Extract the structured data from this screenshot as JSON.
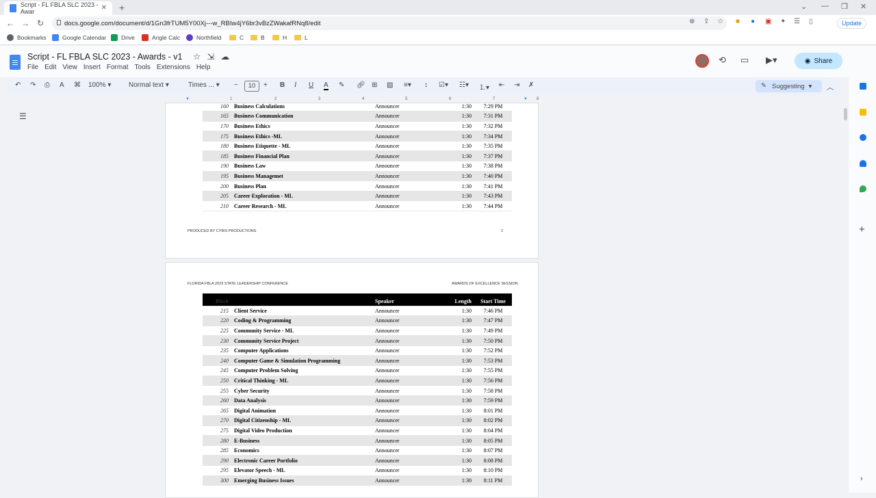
{
  "browser": {
    "tab_title": "Script - FL FBLA SLC 2023 - Awar",
    "url": "docs.google.com/document/d/1Gn3frTUM5Y00Xj---w_RBIw4jY6br3vBzZWakafRNq8/edit",
    "update_label": "Update",
    "bookmarks": [
      {
        "label": "Bookmarks",
        "icon": "star-icon",
        "color": "#5f6368"
      },
      {
        "label": "Google Calendar",
        "icon": "calendar-icon",
        "color": "#4285f4"
      },
      {
        "label": "Drive",
        "icon": "drive-icon",
        "color": "#0f9d58"
      },
      {
        "label": "Angle Calc",
        "icon": "calculator-icon",
        "color": "#d93025"
      },
      {
        "label": "Northfield",
        "icon": "peace-icon",
        "color": "#5f3dc4"
      },
      {
        "label": "C",
        "icon": "folder-icon",
        "color": "#f2c94c"
      },
      {
        "label": "B",
        "icon": "folder-icon",
        "color": "#f2c94c"
      },
      {
        "label": "H",
        "icon": "folder-icon",
        "color": "#f2c94c"
      },
      {
        "label": "L",
        "icon": "folder-icon",
        "color": "#f2c94c"
      }
    ]
  },
  "docs": {
    "title": "Script - FL FBLA SLC 2023 - Awards - v1",
    "menus": [
      "File",
      "Edit",
      "View",
      "Insert",
      "Format",
      "Tools",
      "Extensions",
      "Help"
    ],
    "share_label": "Share",
    "zoom": "100%",
    "style": "Normal text",
    "font": "Times ...",
    "font_size": "10",
    "mode": "Suggesting"
  },
  "page1": {
    "footer_left": "PRODUCED BY CYBIS PRODUCTIONS",
    "page_number": "2",
    "rows": [
      [
        "160",
        "Business Calculations",
        "Announcer",
        "1:30",
        "7:29 PM"
      ],
      [
        "165",
        "Business Communication",
        "Announcer",
        "1:30",
        "7:31 PM"
      ],
      [
        "170",
        "Business Ethics",
        "Announcer",
        "1:30",
        "7:32 PM"
      ],
      [
        "175",
        "Business Ethics -ML",
        "Announcer",
        "1:30",
        "7:34 PM"
      ],
      [
        "180",
        "Business Etiquette - ML",
        "Announcer",
        "1:30",
        "7:35 PM"
      ],
      [
        "185",
        "Business Financial Plan",
        "Announcer",
        "1:30",
        "7:37 PM"
      ],
      [
        "190",
        "Business Law",
        "Announcer",
        "1:30",
        "7:38 PM"
      ],
      [
        "195",
        "Business Managemet",
        "Announcer",
        "1:30",
        "7:40 PM"
      ],
      [
        "200",
        "Business Plan",
        "Announcer",
        "1:30",
        "7:41 PM"
      ],
      [
        "205",
        "Career Exploration - ML",
        "Announcer",
        "1:30",
        "7:43 PM"
      ],
      [
        "210",
        "Career Research - ML",
        "Announcer",
        "1:30",
        "7:44 PM"
      ]
    ]
  },
  "page2": {
    "header_left": "FLORIDA FBLA 2023 STATE LEADERSHIP CONFERENCE",
    "header_right": "AWARDS OF EXCELLENCE SESSION",
    "columns": {
      "block": "Block",
      "speaker": "Speaker",
      "length": "Length",
      "start": "Start Time"
    },
    "rows": [
      [
        "215",
        "Client Service",
        "Announcer",
        "1:30",
        "7:46 PM"
      ],
      [
        "220",
        "Coding & Programming",
        "Announcer",
        "1:30",
        "7:47 PM"
      ],
      [
        "225",
        "Community Service - ML",
        "Announcer",
        "1:30",
        "7:49 PM"
      ],
      [
        "230",
        "Community Service Project",
        "Announcer",
        "1:30",
        "7:50 PM"
      ],
      [
        "235",
        "Computer Applications",
        "Announcer",
        "1:30",
        "7:52 PM"
      ],
      [
        "240",
        "Computer Game & Simulation Programming",
        "Announcer",
        "1:30",
        "7:53 PM"
      ],
      [
        "245",
        "Computer Problem Solving",
        "Announcer",
        "1:30",
        "7:55 PM"
      ],
      [
        "250",
        "Critical Thinking - ML",
        "Announcer",
        "1:30",
        "7:56 PM"
      ],
      [
        "255",
        "Cyber Security",
        "Announcer",
        "1:30",
        "7:58 PM"
      ],
      [
        "260",
        "Data Analysis",
        "Announcer",
        "1:30",
        "7:59 PM"
      ],
      [
        "265",
        "Digital Animation",
        "Announcer",
        "1:30",
        "8:01 PM"
      ],
      [
        "270",
        "Digital Citizenship - ML",
        "Announcer",
        "1:30",
        "8:02 PM"
      ],
      [
        "275",
        "Digital Video Production",
        "Announcer",
        "1:30",
        "8:04 PM"
      ],
      [
        "280",
        "E-Business",
        "Announcer",
        "1:30",
        "8:05 PM"
      ],
      [
        "285",
        "Economics",
        "Announcer",
        "1:30",
        "8:07 PM"
      ],
      [
        "290",
        "Electronic Career Portfolio",
        "Announcer",
        "1:30",
        "8:08 PM"
      ],
      [
        "295",
        "Elevator Speech - ML",
        "Announcer",
        "1:30",
        "8:10 PM"
      ],
      [
        "300",
        "Emerging Business Issues",
        "Announcer",
        "1:30",
        "8:11 PM"
      ]
    ]
  }
}
